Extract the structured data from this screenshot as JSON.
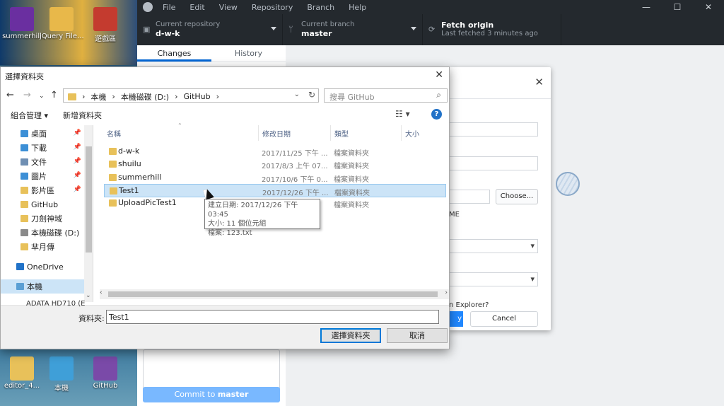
{
  "desktop": {
    "icons_top": [
      {
        "label": "summerhill",
        "color": "#6a2fa0"
      },
      {
        "label": "jQuery File...",
        "color": "#e8b84a"
      },
      {
        "label": "遊戲區",
        "color": "#c43b2f"
      }
    ],
    "icons_bottom": [
      {
        "label": "editor_4...",
        "color": "#e8c15a"
      },
      {
        "label": "本機",
        "color": "#3f9fd8"
      },
      {
        "label": "GitHub",
        "color": "#7a4aa8"
      }
    ]
  },
  "github": {
    "menu": [
      "File",
      "Edit",
      "View",
      "Repository",
      "Branch",
      "Help"
    ],
    "window_controls": [
      "—",
      "☐",
      "✕"
    ],
    "repo_label": "Current repository",
    "repo_value": "d-w-k",
    "branch_label": "Current branch",
    "branch_value": "master",
    "fetch_label": "Fetch origin",
    "fetch_sub": "Last fetched 3 minutes ago",
    "tabs": [
      "Changes",
      "History"
    ],
    "commit_prefix": "Commit to ",
    "commit_branch": "master",
    "clone_dialog": {
      "choose_button": "Choose...",
      "fragment_me": "ME",
      "fragment_explorer": "n Explorer?",
      "ok_fragment": "y",
      "cancel_button": "Cancel"
    }
  },
  "picker": {
    "title": "選擇資料夾",
    "address": [
      "本機",
      "本機磁碟 (D:)",
      "GitHub"
    ],
    "search_placeholder": "搜尋 GitHub",
    "organize": "組合管理 ▾",
    "new_folder": "新增資料夾",
    "tree": [
      {
        "label": "桌面",
        "pinned": true,
        "color": "#3c8fd6"
      },
      {
        "label": "下載",
        "pinned": true,
        "color": "#3c8fd6"
      },
      {
        "label": "文件",
        "pinned": true,
        "color": "#6f8fb3"
      },
      {
        "label": "圖片",
        "pinned": true,
        "color": "#3c8fd6"
      },
      {
        "label": "影片區",
        "pinned": true,
        "color": "#e8c15a"
      },
      {
        "label": "GitHub",
        "pinned": false,
        "color": "#e8c15a"
      },
      {
        "label": "刀劍神域",
        "pinned": false,
        "color": "#e8c15a"
      },
      {
        "label": "本機磁碟 (D:)",
        "pinned": false,
        "color": "#8a8a8a"
      },
      {
        "label": "芈月傳",
        "pinned": false,
        "color": "#e8c15a"
      },
      {
        "label": "OneDrive",
        "pinned": false,
        "color": "#2172c8"
      },
      {
        "label": "本機",
        "pinned": false,
        "color": "#5a9fd4"
      }
    ],
    "columns": [
      "名稱",
      "修改日期",
      "類型",
      "大小"
    ],
    "rows": [
      {
        "name": "d-w-k",
        "date": "2017/11/25 下午 ...",
        "type": "檔案資料夾",
        "selected": false
      },
      {
        "name": "shuilu",
        "date": "2017/8/3 上午 07...",
        "type": "檔案資料夾",
        "selected": false
      },
      {
        "name": "summerhill",
        "date": "2017/10/6 下午 0...",
        "type": "檔案資料夾",
        "selected": false
      },
      {
        "name": "Test1",
        "date": "2017/12/26 下午 ...",
        "type": "檔案資料夾",
        "selected": true
      },
      {
        "name": "UploadPicTest1",
        "date": "",
        "type": "檔案資料夾",
        "selected": false
      }
    ],
    "tooltip": [
      "建立日期: 2017/12/26 下午 03:45",
      "大小: 11 個位元組",
      "檔案: 123.txt"
    ],
    "folder_peek": "ADATA HD710 (E",
    "folder_label": "資料夾:",
    "folder_value": "Test1",
    "select_button": "選擇資料夾",
    "cancel_button": "取消"
  }
}
